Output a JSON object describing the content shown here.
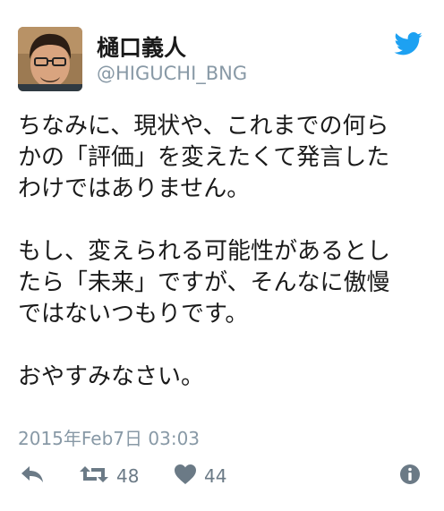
{
  "tweet": {
    "display_name": "樋口義人",
    "handle": "@HIGUCHI_BNG",
    "body_lines": [
      "ちなみに、現状や、これまでの何ら",
      "かの「評価」を変えたくて発言した",
      "わけではありません。",
      "",
      "もし、変えられる可能性があるとし",
      "たら「未来」ですが、そんなに傲慢",
      "ではないつもりです。",
      "",
      "おやすみなさい。"
    ],
    "timestamp": "2015年Feb7日 03:03",
    "retweet_count": "48",
    "like_count": "44"
  },
  "icons": {
    "brand": "twitter-bird-icon",
    "reply": "reply-arrow-icon",
    "retweet": "retweet-icon",
    "like": "heart-icon",
    "more": "info-icon"
  },
  "colors": {
    "twitter_blue": "#1da1f2",
    "muted": "#8899a6",
    "icon_gray": "#6b7a86",
    "text": "#1a1a1a"
  }
}
